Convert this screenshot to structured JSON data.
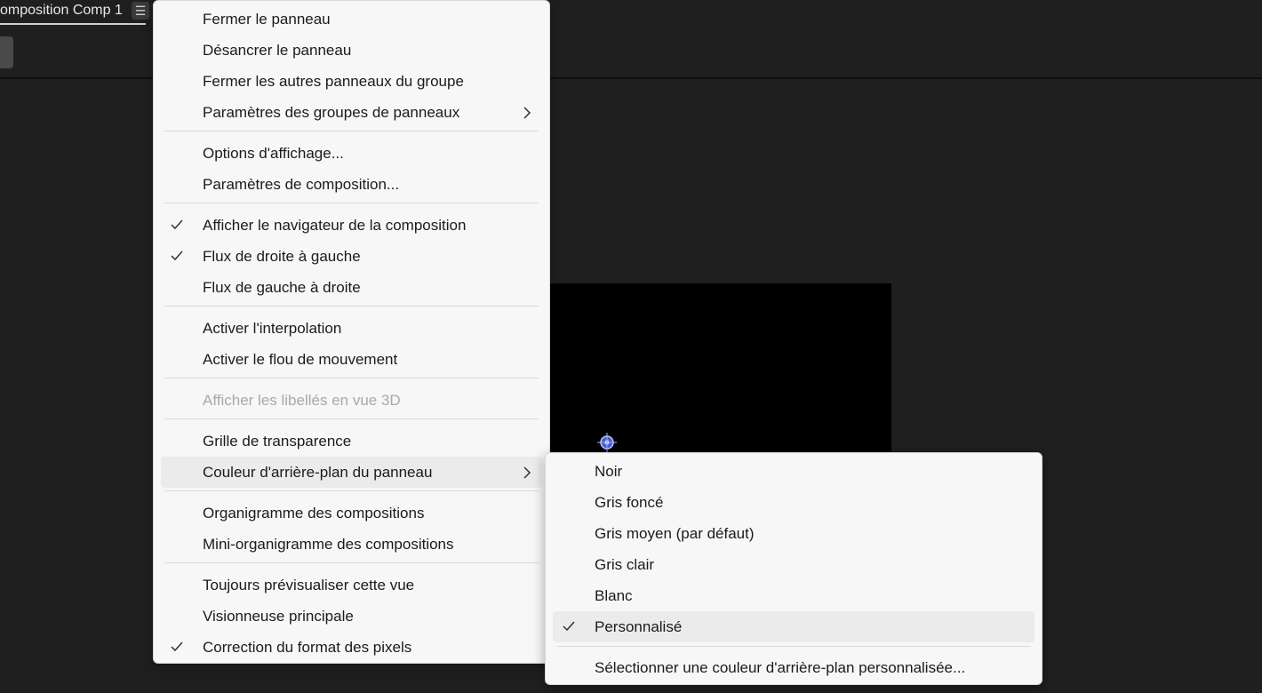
{
  "panel": {
    "tab_title": "omposition Comp 1",
    "menu_glyph": "☰"
  },
  "icons": {
    "check": "check-icon",
    "chevron": "chevron-right-icon",
    "anchor": "anchor-point-icon",
    "menu": "hamburger-menu-icon"
  },
  "main_menu": {
    "items": [
      {
        "label": "Fermer le panneau",
        "checked": false,
        "submenu": false
      },
      {
        "label": "Désancrer le panneau",
        "checked": false,
        "submenu": false
      },
      {
        "label": "Fermer les autres panneaux du groupe",
        "checked": false,
        "submenu": false
      },
      {
        "label": "Paramètres des groupes de panneaux",
        "checked": false,
        "submenu": true
      },
      {
        "label": "Options d'affichage...",
        "checked": false,
        "submenu": false
      },
      {
        "label": "Paramètres de composition...",
        "checked": false,
        "submenu": false
      },
      {
        "label": "Afficher le navigateur de la composition",
        "checked": true,
        "submenu": false
      },
      {
        "label": "Flux de droite à gauche",
        "checked": true,
        "submenu": false
      },
      {
        "label": "Flux de gauche à droite",
        "checked": false,
        "submenu": false
      },
      {
        "label": "Activer l'interpolation",
        "checked": false,
        "submenu": false
      },
      {
        "label": "Activer le flou de mouvement",
        "checked": false,
        "submenu": false
      },
      {
        "label": "Afficher les libellés en vue 3D",
        "checked": false,
        "submenu": false,
        "disabled": true
      },
      {
        "label": "Grille de transparence",
        "checked": false,
        "submenu": false
      },
      {
        "label": "Couleur d'arrière-plan du panneau",
        "checked": false,
        "submenu": true,
        "highlighted": true
      },
      {
        "label": "Organigramme des compositions",
        "checked": false,
        "submenu": false
      },
      {
        "label": "Mini-organigramme des compositions",
        "checked": false,
        "submenu": false
      },
      {
        "label": "Toujours prévisualiser cette vue",
        "checked": false,
        "submenu": false
      },
      {
        "label": "Visionneuse principale",
        "checked": false,
        "submenu": false
      },
      {
        "label": "Correction du format des pixels",
        "checked": true,
        "submenu": false
      }
    ]
  },
  "sub_menu": {
    "items": [
      {
        "label": "Noir",
        "checked": false
      },
      {
        "label": "Gris foncé",
        "checked": false
      },
      {
        "label": "Gris moyen (par défaut)",
        "checked": false
      },
      {
        "label": "Gris clair",
        "checked": false
      },
      {
        "label": "Blanc",
        "checked": false
      },
      {
        "label": "Personnalisé",
        "checked": true,
        "highlighted": true
      },
      {
        "label": "Sélectionner une couleur d'arrière-plan personnalisée...",
        "checked": false
      }
    ]
  }
}
